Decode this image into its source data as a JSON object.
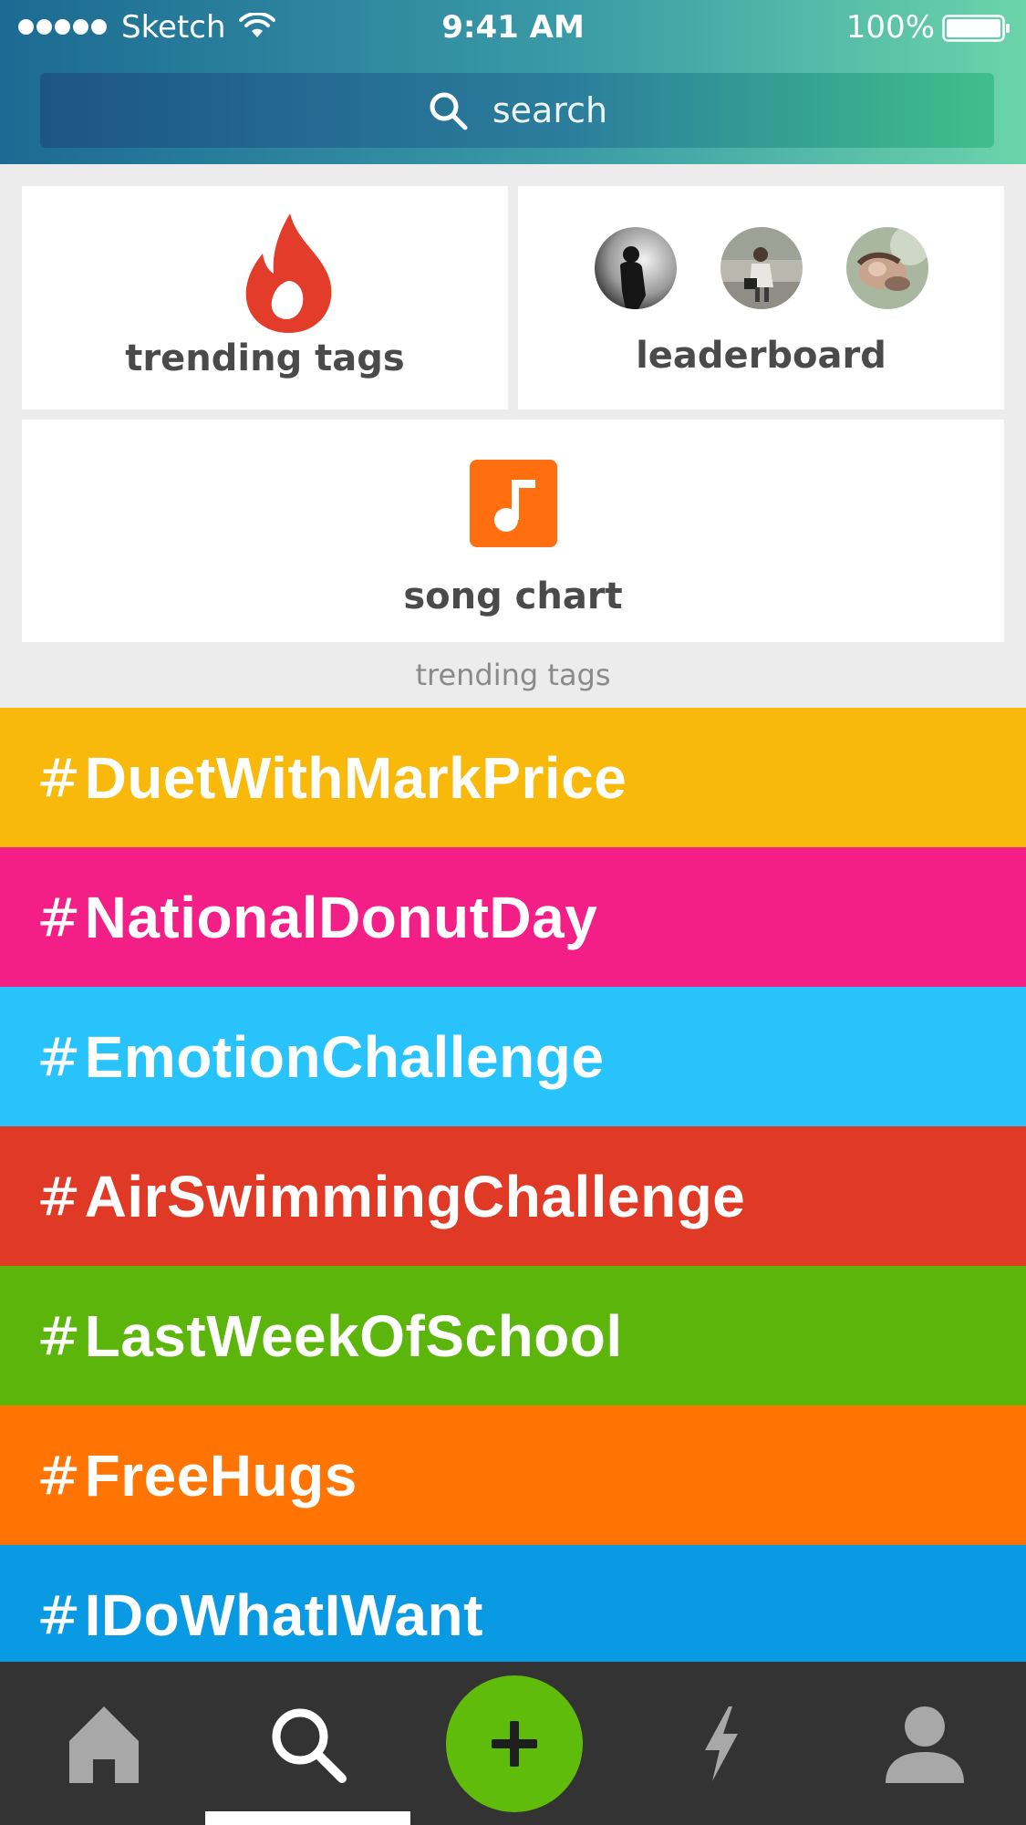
{
  "status_bar": {
    "carrier": "Sketch",
    "time": "9:41 AM",
    "battery": "100%"
  },
  "search": {
    "placeholder": "search",
    "icon": "search-icon"
  },
  "tiles": {
    "trending_tags": {
      "label": "trending tags",
      "icon": "flame-icon",
      "icon_color": "#e33c2a"
    },
    "leaderboard": {
      "label": "leaderboard",
      "avatar_count": 3
    },
    "song_chart": {
      "label": "song chart",
      "icon": "music-note-icon",
      "icon_color": "#ff6f0f"
    }
  },
  "section_caption": "trending tags",
  "tags": [
    {
      "hash": "#",
      "text": "DuetWithMarkPrice",
      "color": "#f9b90a"
    },
    {
      "hash": "#",
      "text": "NationalDonutDay",
      "color": "#f31f86"
    },
    {
      "hash": "#",
      "text": "EmotionChallenge",
      "color": "#29c3fc"
    },
    {
      "hash": "#",
      "text": "AirSwimmingChallenge",
      "color": "#e03a26"
    },
    {
      "hash": "#",
      "text": "LastWeekOfSchool",
      "color": "#5bb50a"
    },
    {
      "hash": "#",
      "text": "FreeHugs",
      "color": "#ff7403"
    },
    {
      "hash": "#",
      "text": "IDoWhatIWant",
      "color": "#0a9ae3"
    }
  ],
  "tab_bar": {
    "items": [
      {
        "name": "home",
        "icon": "home-icon"
      },
      {
        "name": "search",
        "icon": "search-icon",
        "active": true
      },
      {
        "name": "create",
        "icon": "plus-icon",
        "color": "#5fbc0b"
      },
      {
        "name": "activity",
        "icon": "lightning-icon"
      },
      {
        "name": "profile",
        "icon": "person-icon"
      }
    ]
  }
}
